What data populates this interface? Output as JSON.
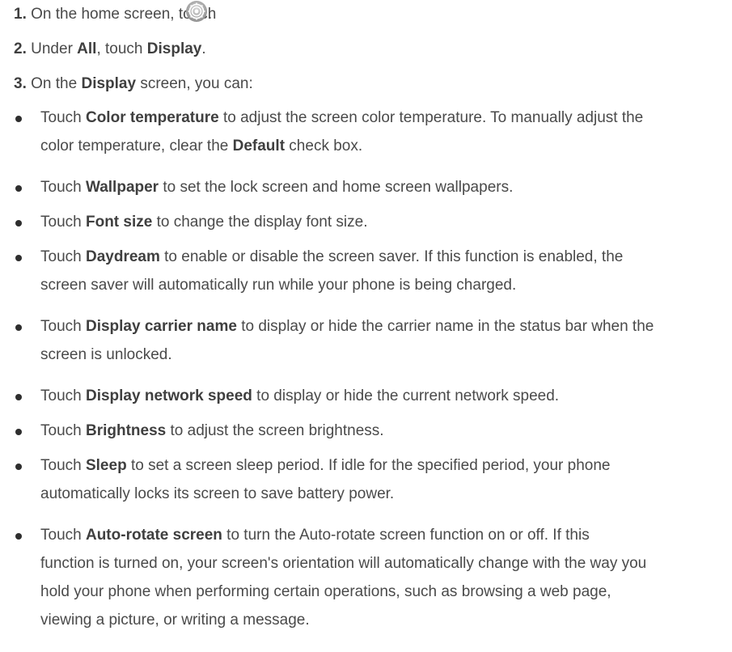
{
  "steps": [
    {
      "num": "1.",
      "text_before": "On the home screen, touch",
      "text_after": " ."
    },
    {
      "num": "2.",
      "t1": "Under ",
      "b1": "All",
      "t2": ", touch ",
      "b2": "Display",
      "t3": "."
    },
    {
      "num": "3.",
      "t1": "On the ",
      "b1": "Display",
      "t2": " screen, you can:"
    }
  ],
  "settings_icon": "settings-gear-icon",
  "bullets": [
    {
      "t1": "Touch ",
      "b1": "Color temperature",
      "t2": " to adjust the screen color temperature. To manually adjust the",
      "l2a": "color temperature, clear the ",
      "b2": "Default",
      "l2b": " check box."
    },
    {
      "t1": "Touch ",
      "b1": "Wallpaper",
      "t2": " to set the lock screen and home screen wallpapers."
    },
    {
      "t1": "Touch ",
      "b1": "Font size",
      "t2": " to change the display font size."
    },
    {
      "t1": "Touch ",
      "b1": "Daydream",
      "t2": " to enable or disable the screen saver. If this function is enabled, the",
      "l2": "screen saver will automatically run while your phone is being charged."
    },
    {
      "t1": "Touch ",
      "b1": "Display carrier name",
      "t2": " to display or hide the carrier name in the status bar when the",
      "l2": "screen is unlocked."
    },
    {
      "t1": "Touch ",
      "b1": "Display network speed",
      "t2": " to display or hide the current network speed."
    },
    {
      "t1": "Touch ",
      "b1": "Brightness",
      "t2": " to adjust the screen brightness."
    },
    {
      "t1": "Touch ",
      "b1": "Sleep",
      "t2": " to set a screen sleep period. If idle for the specified period, your phone",
      "l2": "automatically locks its screen to save battery power."
    },
    {
      "t1": "Touch ",
      "b1": "Auto-rotate screen",
      "t2": " to turn the Auto-rotate screen function on or off. If this",
      "l2": "function is turned on, your screen's orientation will automatically change with the way you",
      "l3": "hold your phone when performing certain operations, such as browsing a web page,",
      "l4": "viewing a picture, or writing a message."
    }
  ]
}
